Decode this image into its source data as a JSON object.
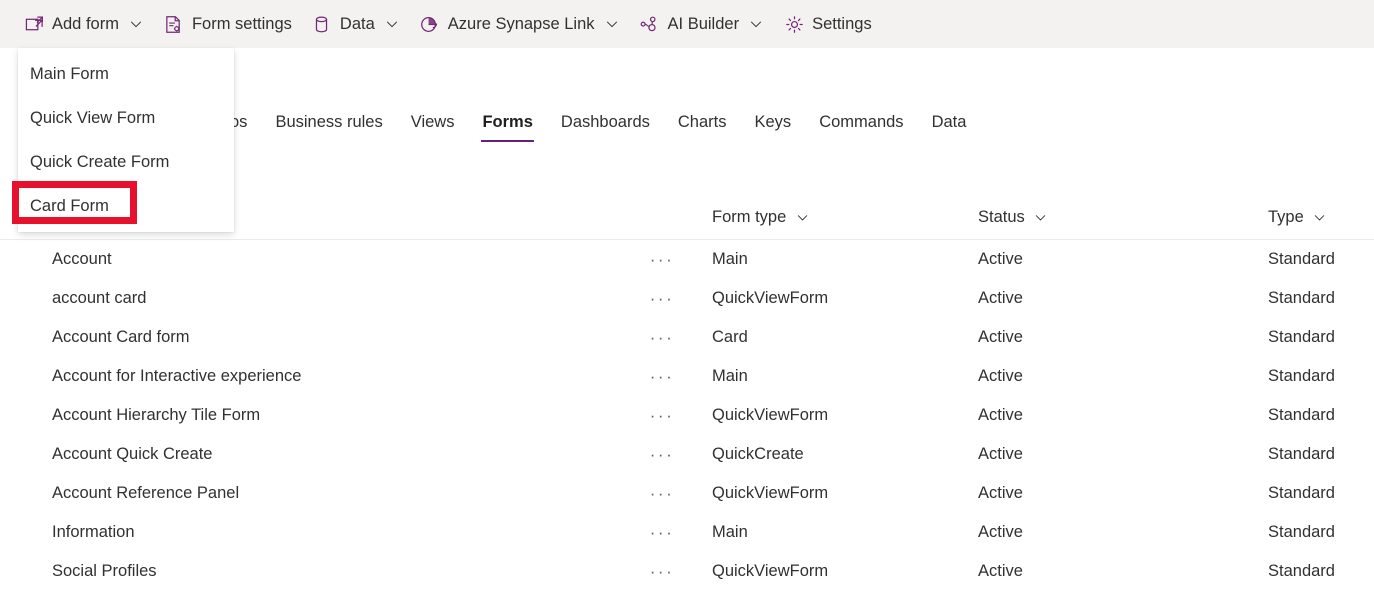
{
  "commandbar": {
    "items": [
      {
        "label": "Add form",
        "icon": "add-form-icon",
        "has_chevron": true
      },
      {
        "label": "Form settings",
        "icon": "form-settings-icon",
        "has_chevron": false
      },
      {
        "label": "Data",
        "icon": "database-icon",
        "has_chevron": true
      },
      {
        "label": "Azure Synapse Link",
        "icon": "azure-synapse-icon",
        "has_chevron": true
      },
      {
        "label": "AI Builder",
        "icon": "ai-builder-icon",
        "has_chevron": true
      },
      {
        "label": "Settings",
        "icon": "gear-icon",
        "has_chevron": false
      }
    ]
  },
  "add_form_menu": {
    "items": [
      {
        "label": "Main Form"
      },
      {
        "label": "Quick View Form"
      },
      {
        "label": "Quick Create Form"
      },
      {
        "label": "Card Form"
      }
    ],
    "highlighted_item": "Card Form"
  },
  "tabs": {
    "items": [
      {
        "label": "os",
        "active": false
      },
      {
        "label": "Business rules",
        "active": false
      },
      {
        "label": "Views",
        "active": false
      },
      {
        "label": "Forms",
        "active": true
      },
      {
        "label": "Dashboards",
        "active": false
      },
      {
        "label": "Charts",
        "active": false
      },
      {
        "label": "Keys",
        "active": false
      },
      {
        "label": "Commands",
        "active": false
      },
      {
        "label": "Data",
        "active": false
      }
    ],
    "active_underline_color": "#68217A"
  },
  "grid": {
    "columns": [
      {
        "label": "",
        "key": "name",
        "sortable": false
      },
      {
        "label": "Form type",
        "key": "form_type",
        "sortable": true
      },
      {
        "label": "Status",
        "key": "status",
        "sortable": true
      },
      {
        "label": "Type",
        "key": "type",
        "sortable": true
      }
    ],
    "rows": [
      {
        "name": "Account",
        "more": "···",
        "form_type": "Main",
        "status": "Active",
        "type": "Standard"
      },
      {
        "name": "account card",
        "more": "···",
        "form_type": "QuickViewForm",
        "status": "Active",
        "type": "Standard"
      },
      {
        "name": "Account Card form",
        "more": "···",
        "form_type": "Card",
        "status": "Active",
        "type": "Standard"
      },
      {
        "name": "Account for Interactive experience",
        "more": "···",
        "form_type": "Main",
        "status": "Active",
        "type": "Standard"
      },
      {
        "name": "Account Hierarchy Tile Form",
        "more": "···",
        "form_type": "QuickViewForm",
        "status": "Active",
        "type": "Standard"
      },
      {
        "name": "Account Quick Create",
        "more": "···",
        "form_type": "QuickCreate",
        "status": "Active",
        "type": "Standard"
      },
      {
        "name": "Account Reference Panel",
        "more": "···",
        "form_type": "QuickViewForm",
        "status": "Active",
        "type": "Standard"
      },
      {
        "name": "Information",
        "more": "···",
        "form_type": "Main",
        "status": "Active",
        "type": "Standard"
      },
      {
        "name": "Social Profiles",
        "more": "···",
        "form_type": "QuickViewForm",
        "status": "Active",
        "type": "Standard"
      }
    ]
  },
  "colors": {
    "commandbar_background": "#F3F2F1",
    "icon_purple": "#742774",
    "accent": "#68217A",
    "text": "#323130",
    "highlight_red": "#E8112D",
    "row_divider": "#EDEBE9"
  }
}
